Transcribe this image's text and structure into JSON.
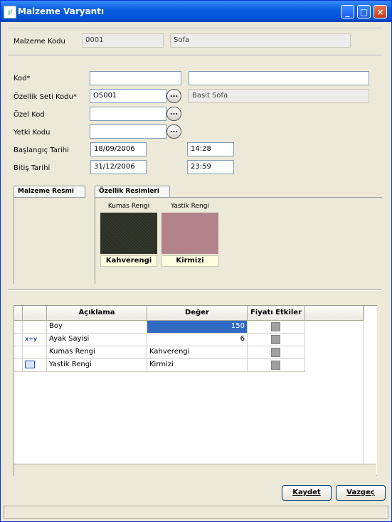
{
  "window": {
    "title": "Malzeme Varyantı",
    "icon_text": "gf"
  },
  "header": {
    "malzeme_kodu_label": "Malzeme Kodu",
    "malzeme_kodu_value": "0001",
    "malzeme_adi_value": "Sofa"
  },
  "form": {
    "kod_label": "Kod*",
    "kod_value": "",
    "kod_desc_value": "",
    "ozellik_seti_label": "Özellik Seti Kodu*",
    "ozellik_seti_value": "OS001",
    "ozellik_seti_desc": "Basit Sofa",
    "ozel_kod_label": "Özel Kod",
    "ozel_kod_value": "",
    "yetki_kodu_label": "Yetki Kodu",
    "yetki_kodu_value": "",
    "baslangic_label": "Başlangıç Tarihi",
    "baslangic_date": "18/09/2006",
    "baslangic_time": "14:28",
    "bitis_label": "Bitiş Tarihi",
    "bitis_date": "31/12/2006",
    "bitis_time": "23:59",
    "ellipsis": "..."
  },
  "tabs": {
    "malzeme_resmi": "Malzeme Resmi",
    "ozellik_resimleri": "Özellik Resimleri"
  },
  "swatches": [
    {
      "caption": "Kumas Rengi",
      "label": "Kahverengi",
      "color": "#2a2e22"
    },
    {
      "caption": "Yastik Rengi",
      "label": "Kirmizi",
      "color": "#b08088"
    }
  ],
  "grid": {
    "columns": [
      "Açıklama",
      "Değer",
      "Fiyatı Etkiler"
    ],
    "rows": [
      {
        "aciklama": "Boy",
        "deger": "150",
        "selected": true,
        "icon": ""
      },
      {
        "aciklama": "Ayak Sayisi",
        "deger": "6",
        "selected": false,
        "icon": "formula-icon"
      },
      {
        "aciklama": "Kumas Rengi",
        "deger": "Kahverengi",
        "selected": false,
        "icon": ""
      },
      {
        "aciklama": "Yastik Rengi",
        "deger": "Kirmizi",
        "selected": false,
        "icon": "list-icon"
      }
    ],
    "formula_glyph": "x+y"
  },
  "buttons": {
    "kaydet": "Kaydet",
    "vazgec": "Vazgeç"
  },
  "colors": {
    "titlebar": "#0a5fe0",
    "selection": "#316ac5"
  }
}
